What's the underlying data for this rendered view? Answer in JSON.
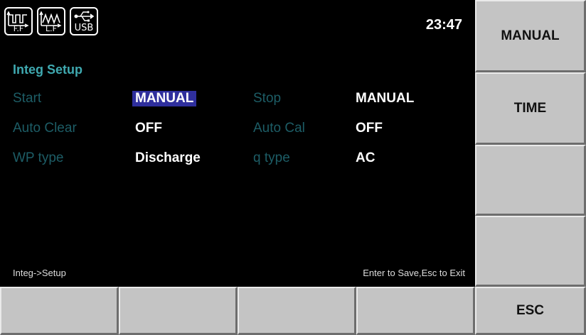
{
  "status": {
    "icons": [
      {
        "name": "ff-filter-icon",
        "label": "F.F"
      },
      {
        "name": "lf-filter-icon",
        "label": "L.F"
      },
      {
        "name": "usb-icon",
        "label": "USB"
      }
    ],
    "time": "23:47"
  },
  "screen": {
    "title": "Integ Setup",
    "params": [
      {
        "label": "Start",
        "value": "MANUAL",
        "selected": true
      },
      {
        "label": "Stop",
        "value": "MANUAL"
      },
      {
        "label": "Auto Clear",
        "value": "OFF"
      },
      {
        "label": "Auto Cal",
        "value": "OFF"
      },
      {
        "label": "WP type",
        "value": "Discharge"
      },
      {
        "label": "q type",
        "value": "AC"
      }
    ],
    "breadcrumb": "Integ->Setup",
    "hint": "Enter to Save,Esc to Exit"
  },
  "softkeys": {
    "right": [
      "MANUAL",
      "TIME",
      "",
      ""
    ],
    "bottom": [
      "",
      "",
      "",
      ""
    ],
    "esc": "ESC"
  },
  "colors": {
    "title": "#3fa9b0",
    "label": "#1d5d66",
    "selection": "#2f2f9d",
    "softkey": "#c4c4c4"
  }
}
